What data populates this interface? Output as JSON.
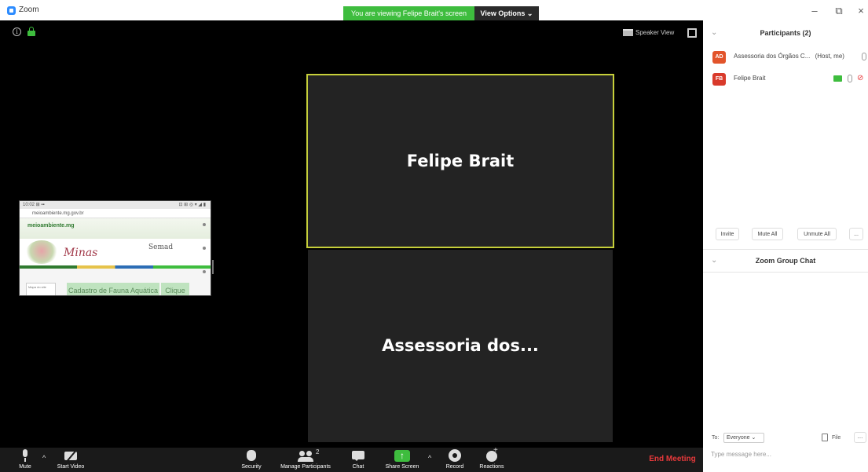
{
  "window": {
    "title": "Zoom",
    "viewing_banner": "You are viewing Felipe Brait's screen",
    "view_options_label": "View Options ⌄",
    "minimize_glyph": "–",
    "maximize_glyph": "⧉",
    "close_glyph": "×"
  },
  "video": {
    "info_glyph": "i",
    "speaker_view_label": "Speaker View",
    "shared_screen": {
      "status": "10:02 ⊞ ▪▪",
      "status_right": "⊡ ⊞ ◎ ▾ ◢ ▮",
      "url": "meioambiente.mg.gov.br",
      "site_logo": "meioambiente.mg",
      "site_cursive": "Minas",
      "site_semad": "Semad",
      "box_left": "Mapa do site",
      "box_mid": "Cadastro de Fauna Aquática",
      "box_right": "Clique"
    },
    "tiles": [
      {
        "name": "Felipe Brait"
      },
      {
        "name": "Assessoria dos..."
      }
    ]
  },
  "toolbar": {
    "mute": "Mute",
    "start_video": "Start Video",
    "security": "Security",
    "manage_participants": "Manage Participants",
    "participants_count": "2",
    "chat": "Chat",
    "share_screen": "Share Screen",
    "record": "Record",
    "reactions": "Reactions",
    "end_meeting": "End Meeting",
    "caret": "^"
  },
  "participants_panel": {
    "title": "Participants (2)",
    "collapse_glyph": "⌄",
    "participants": [
      {
        "initials": "AD",
        "name": "Assessoria dos Órgãos C...",
        "suffix": "(Host, me)",
        "color": "#e2542b"
      },
      {
        "initials": "FB",
        "name": "Felipe Brait",
        "color": "#d93a2b"
      }
    ],
    "actions": {
      "invite": "Invite",
      "mute_all": "Mute All",
      "unmute_all": "Unmute All",
      "more": "..."
    }
  },
  "chat_panel": {
    "title": "Zoom Group Chat",
    "collapse_glyph": "⌄",
    "to_label": "To:",
    "to_value": "Everyone ⌄",
    "file_label": "File",
    "more": "...",
    "input_placeholder": "Type message here..."
  },
  "colors": {
    "accent_green": "#3ebd3e",
    "active_speaker_border": "#c6cf3a",
    "end_meeting_red": "#e8393b"
  },
  "icons": [
    "zoom-app-icon",
    "info-icon",
    "lock-icon",
    "grid-icon",
    "fullscreen-icon",
    "microphone-icon",
    "video-camera-icon",
    "shield-icon",
    "participants-icon",
    "chat-icon",
    "share-screen-icon",
    "record-icon",
    "reactions-icon",
    "file-icon"
  ]
}
